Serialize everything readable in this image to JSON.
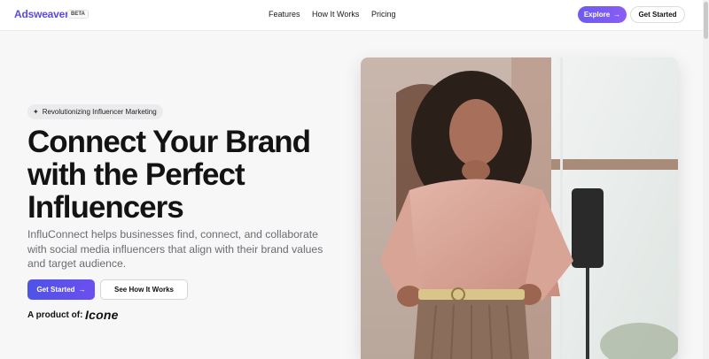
{
  "header": {
    "brand": "Adsweaver",
    "beta_badge": "BETA",
    "links": [
      {
        "label": "Features"
      },
      {
        "label": "How It Works"
      },
      {
        "label": "Pricing"
      }
    ],
    "explore_label": "Explore",
    "get_started_label": "Get Started"
  },
  "hero": {
    "pill_label": "Revolutionizing Influencer Marketing",
    "headline_line1": "Connect Your Brand",
    "headline_line2": "with the Perfect",
    "headline_line3": "Influencers",
    "description": "InfluConnect helps businesses find, connect, and collaborate with social media influencers that align with their brand values and target audience.",
    "primary_button": "Get Started",
    "secondary_button": "See How It Works",
    "product_of_label": "A product of:",
    "product_logo_text": "Icone"
  },
  "icons": {
    "sparkle": "sparkle-icon",
    "arrow": "arrow-right-icon"
  },
  "colors": {
    "brand": "#5b4be0",
    "accent_gradient_start": "#4e53e6",
    "accent_gradient_end": "#6b4ff0",
    "explore_start": "#6b5cf0",
    "explore_end": "#8a5cf5"
  }
}
